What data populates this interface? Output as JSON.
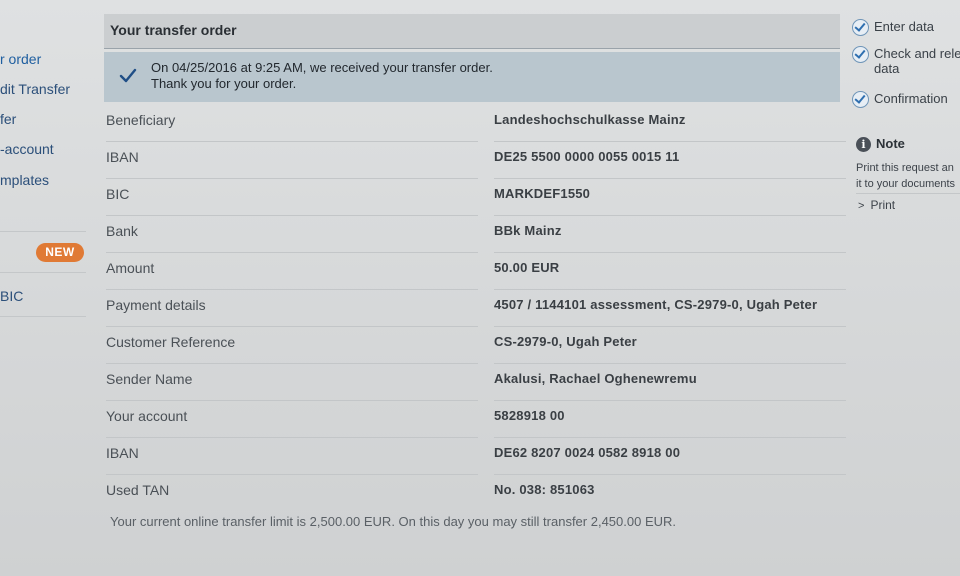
{
  "nav": {
    "items": [
      {
        "label": "r order"
      },
      {
        "label": "dit Transfer"
      },
      {
        "label": "fer"
      },
      {
        "label": "-account"
      },
      {
        "label": "mplates"
      },
      {
        "label": "BIC"
      }
    ],
    "new_badge": "NEW"
  },
  "panel": {
    "title": "Your transfer order",
    "success_line1": "On 04/25/2016 at 9:25 AM, we received your transfer order.",
    "success_line2": "Thank you for your order."
  },
  "details": [
    {
      "label": "Beneficiary",
      "value": "Landeshochschulkasse Mainz"
    },
    {
      "label": "IBAN",
      "value": "DE25 5500 0000 0055 0015 11"
    },
    {
      "label": "BIC",
      "value": "MARKDEF1550"
    },
    {
      "label": "Bank",
      "value": "BBk Mainz"
    },
    {
      "label": "Amount",
      "value": "50.00 EUR"
    },
    {
      "label": "Payment details",
      "value": "4507 / 1144101 assessment, CS-2979-0, Ugah Peter"
    },
    {
      "label": "Customer Reference",
      "value": "CS-2979-0, Ugah Peter"
    },
    {
      "label": "Sender Name",
      "value": "Akalusi, Rachael Oghenewremu"
    },
    {
      "label": "Your account",
      "value": "5828918 00"
    },
    {
      "label": "IBAN",
      "value": "DE62 8207 0024 0582 8918 00"
    },
    {
      "label": "Used TAN",
      "value": "No. 038: 851063"
    }
  ],
  "limit_text": "Your current online transfer limit is 2,500.00 EUR. On this day you may still transfer 2,450.00 EUR.",
  "steps": [
    {
      "line1": "Enter data",
      "line2": ""
    },
    {
      "line1": "Check and rele",
      "line2": "data"
    },
    {
      "line1": "Confirmation",
      "line2": ""
    }
  ],
  "note": {
    "title": "Note",
    "line1": "Print this request an",
    "line2": "it to your documents",
    "print_label": "Print"
  },
  "colors": {
    "accent_blue": "#2f6fb0",
    "new_badge": "#e07a35",
    "success_bg": "#b9c6ce"
  }
}
